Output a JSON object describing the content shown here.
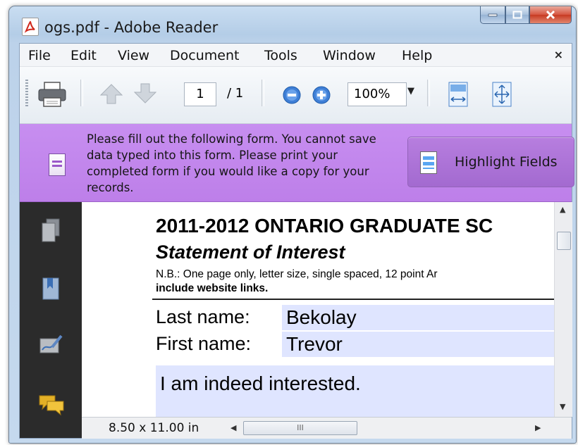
{
  "window": {
    "title": "ogs.pdf - Adobe Reader"
  },
  "menu": {
    "items": [
      "File",
      "Edit",
      "View",
      "Document",
      "Tools",
      "Window",
      "Help"
    ],
    "close_glyph": "×"
  },
  "toolbar": {
    "current_page": "1",
    "page_total": "/ 1",
    "zoom": "100%"
  },
  "notice": {
    "text": "Please fill out the following form. You cannot save data typed into this form. Please print your completed form if you would like a copy for your records.",
    "button_label": "Highlight Fields"
  },
  "document": {
    "title": "2011-2012 ONTARIO GRADUATE SC",
    "subtitle": "Statement of Interest",
    "note_line1": "N.B.: One page only, letter size, single spaced, 12 point Ar",
    "note_line2": "include website links.",
    "last_name_label": "Last name:",
    "last_name_value": "Bekolay",
    "first_name_label": "First name:",
    "first_name_value": "Trevor",
    "statement_value": "I am indeed interested."
  },
  "status": {
    "page_size": "8.50 x 11.00 in",
    "hthumb_grip": "III"
  },
  "icons": {
    "app": "adobe-reader-icon",
    "print": "printer-icon",
    "prev": "up-arrow-icon",
    "next": "down-arrow-icon",
    "zoom_out": "zoom-out-icon",
    "zoom_in": "zoom-in-icon",
    "fit_width": "fit-width-icon",
    "fit_page": "fit-page-icon",
    "form": "form-icon",
    "pages": "pages-icon",
    "bookmarks": "bookmarks-icon",
    "signatures": "signature-icon",
    "comments": "comments-icon"
  },
  "colors": {
    "notice_bar": "#c084ec",
    "field_highlight": "#dfe5ff",
    "nav_panel": "#2b2b2b"
  }
}
